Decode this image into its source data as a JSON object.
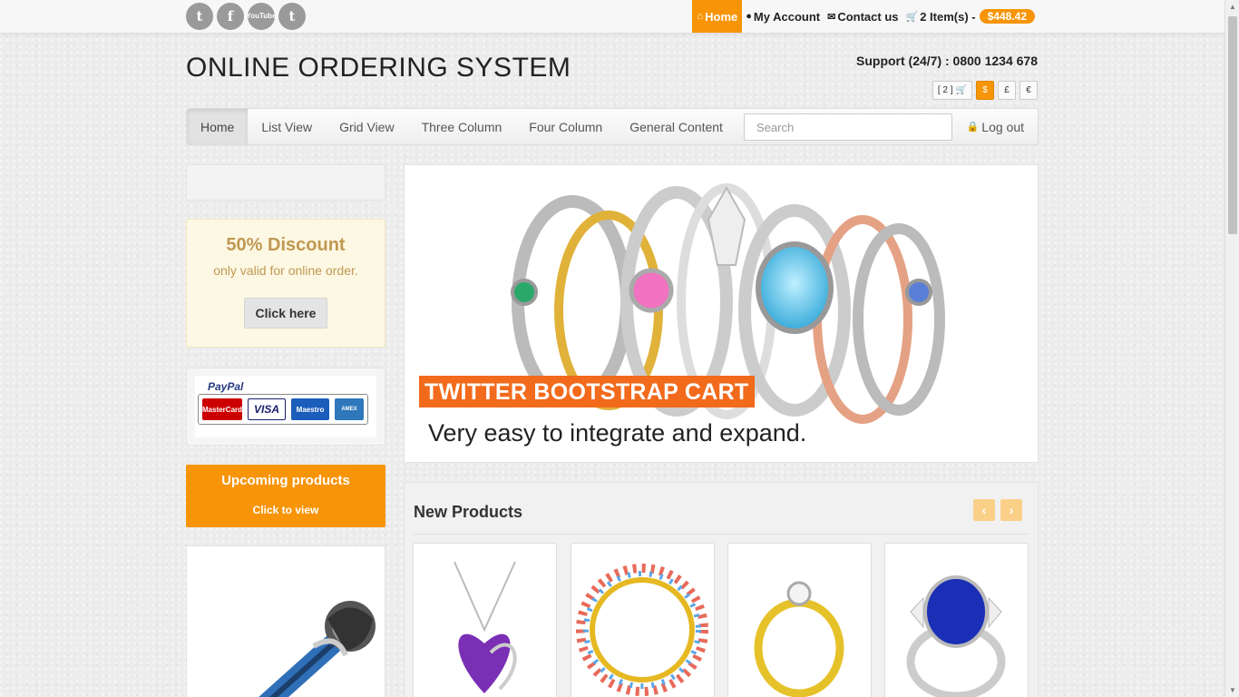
{
  "topbar": {
    "social": [
      "twitter-icon",
      "facebook-icon",
      "youtube-icon",
      "tumblr-icon"
    ],
    "social_glyphs": {
      "twitter": "t",
      "facebook": "f",
      "youtube_top": "You",
      "youtube_bottom": "Tube",
      "tumblr": "t"
    },
    "nav": {
      "home": "Home",
      "account": "My Account",
      "contact": "Contact us",
      "cart": "2 Item(s) -",
      "cart_total": "$448.42"
    }
  },
  "header": {
    "brand": "ONLINE ORDERING SYSTEM",
    "support": "Support (24/7) : 0800 1234 678",
    "mini_cart": "[ 2 ]",
    "currencies": [
      "$",
      "£",
      "€"
    ]
  },
  "nav": {
    "items": [
      "Home",
      "List View",
      "Grid View",
      "Three Column",
      "Four Column",
      "General Content"
    ],
    "search_placeholder": "Search",
    "logout": "Log out"
  },
  "sidebar": {
    "discount_title": "50% Discount",
    "discount_sub": "only valid for online order.",
    "discount_button": "Click here",
    "paypal_label": "PayPal",
    "cards": [
      "MasterCard",
      "VISA",
      "Maestro",
      "AMEX"
    ],
    "upcoming_title": "Upcoming products",
    "upcoming_link": "Click to view"
  },
  "banner": {
    "tag": "TWITTER BOOTSTRAP CART",
    "subtitle": "Very easy to integrate and expand."
  },
  "new_products": {
    "title": "New Products",
    "prev": "‹",
    "next": "›"
  },
  "colors": {
    "accent": "#f79407",
    "banner_tag": "#f26a1b",
    "discount_bg": "#fcf8e3",
    "discount_text": "#c09853"
  }
}
